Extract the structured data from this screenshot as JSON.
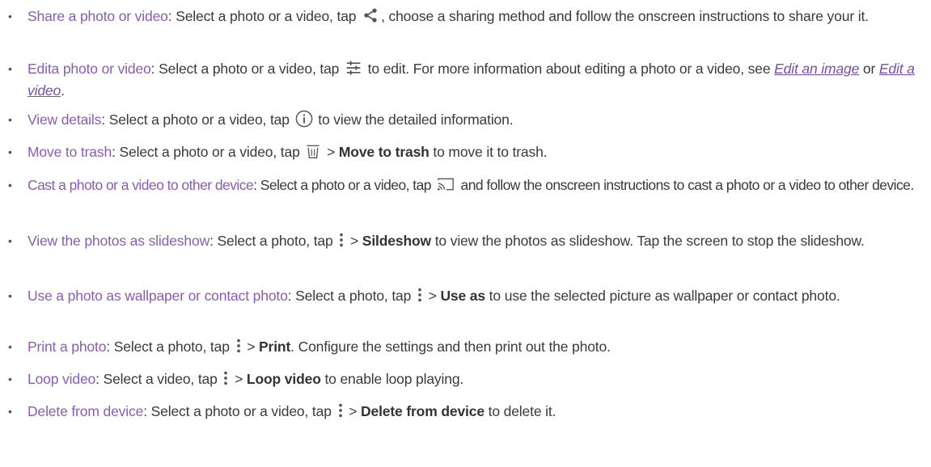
{
  "colors": {
    "term": "#8b5cb5",
    "body": "#3a3a3a",
    "link": "#7a4fa8"
  },
  "items": [
    {
      "term": "Share a photo or video",
      "parts": [
        ": Select a photo or a video, tap ",
        ", choose a sharing method and follow the onscreen instructions to share your it."
      ],
      "icon": "share-icon"
    },
    {
      "term": "Edita photo or video",
      "parts": [
        ": Select a photo or a video, tap ",
        " to edit. For more information about editing a photo or a video, see ",
        " or ",
        "."
      ],
      "icon": "edit-sliders-icon",
      "links": [
        "Edit an image",
        "Edit a video"
      ]
    },
    {
      "term": "View details",
      "parts": [
        ": Select a photo or a video, tap ",
        " to view the detailed information."
      ],
      "icon": "info-icon"
    },
    {
      "term": "Move to trash",
      "parts": [
        ": Select a photo or a video, tap ",
        " > ",
        " to move it to trash."
      ],
      "icon": "trash-icon",
      "bold": "Move to trash"
    },
    {
      "term": "Cast a photo or a video to other device",
      "parts": [
        ": Select a photo or a video, tap ",
        " and follow the onscreen instructions to cast a photo or a video to other device."
      ],
      "icon": "cast-icon"
    },
    {
      "term": "View the photos as slideshow",
      "parts": [
        ": Select a photo, tap ",
        " > ",
        " to view the photos as slideshow. Tap the screen to stop the slideshow."
      ],
      "icon": "more-vertical-icon",
      "bold": "Sildeshow"
    },
    {
      "term": "Use a photo as wallpaper or contact photo",
      "parts": [
        ": Select a photo, tap ",
        " > ",
        " to use the selected picture as wallpaper or contact photo."
      ],
      "icon": "more-vertical-icon",
      "bold": "Use as"
    },
    {
      "term": "Print a photo",
      "parts": [
        ": Select a photo, tap ",
        " > ",
        ". Configure the settings and then print out the photo."
      ],
      "icon": "more-vertical-icon",
      "bold": "Print"
    },
    {
      "term": "Loop video",
      "parts": [
        ": Select a video, tap ",
        " > ",
        " to enable loop playing."
      ],
      "icon": "more-vertical-icon",
      "bold": "Loop video"
    },
    {
      "term": "Delete from device",
      "parts": [
        ": Select a photo or a video, tap ",
        " > ",
        " to delete it."
      ],
      "icon": "more-vertical-icon",
      "bold": "Delete from device"
    }
  ]
}
